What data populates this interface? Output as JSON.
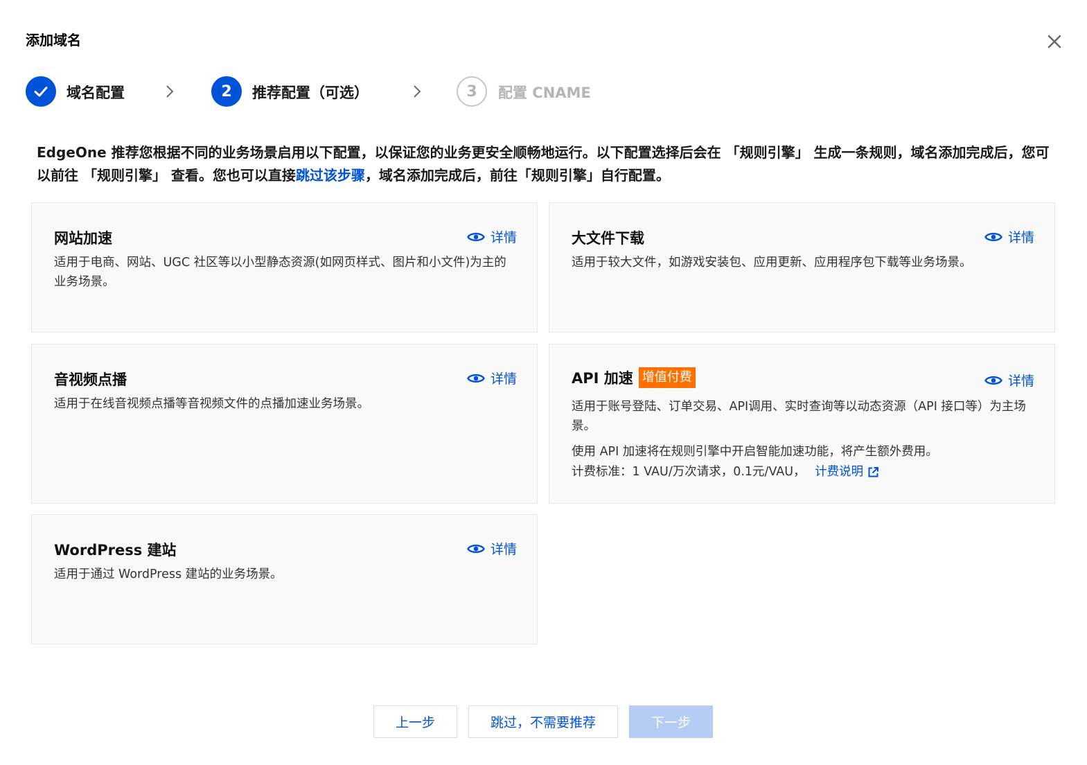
{
  "dialog": {
    "title": "添加域名",
    "close_icon": "close-icon"
  },
  "steps": [
    {
      "number": "1",
      "label": "域名配置",
      "state": "done",
      "icon": "check-icon"
    },
    {
      "number": "2",
      "label": "推荐配置（可选）",
      "state": "active"
    },
    {
      "number": "3",
      "label": "配置 CNAME",
      "state": "todo"
    }
  ],
  "intro": {
    "text_before": "EdgeOne 推荐您根据不同的业务场景启用以下配置，以保证您的业务更安全顺畅地运行。以下配置选择后会在 「规则引擎」 生成一条规则，域名添加完成后，您可以前往 「规则引擎」 查看。您也可以直接",
    "link_text": "跳过该步骤",
    "text_after": "，域名添加完成后，前往「规则引擎」自行配置。"
  },
  "cards": [
    {
      "title": "网站加速",
      "detail_label": "详情",
      "description": "适用于电商、网站、UGC 社区等以小型静态资源(如网页样式、图片和小文件)为主的业务场景。"
    },
    {
      "title": "大文件下载",
      "detail_label": "详情",
      "description": "适用于较大文件，如游戏安装包、应用更新、应用程序包下载等业务场景。"
    },
    {
      "title": "音视频点播",
      "detail_label": "详情",
      "description": "适用于在线音视频点播等音视频文件的点播加速业务场景。"
    },
    {
      "title": "API 加速",
      "badge": "增值付费",
      "detail_label": "详情",
      "description": "适用于账号登陆、订单交易、API调用、实时查询等以动态资源（API 接口等）为主场景。",
      "note": "使用 API 加速将在规则引擎中开启智能加速功能，将产生额外费用。",
      "pricing_text": "计费标准：1 VAU/万次请求，0.1元/VAU，",
      "pricing_link": "计费说明"
    },
    {
      "title": "WordPress 建站",
      "detail_label": "详情",
      "description": "适用于通过 WordPress 建站的业务场景。"
    }
  ],
  "footer": {
    "prev_label": "上一步",
    "skip_label": "跳过，不需要推荐",
    "next_label": "下一步"
  },
  "colors": {
    "primary": "#0052d9",
    "badge": "#ff7000",
    "disabled_button": "#b5cdf5"
  }
}
